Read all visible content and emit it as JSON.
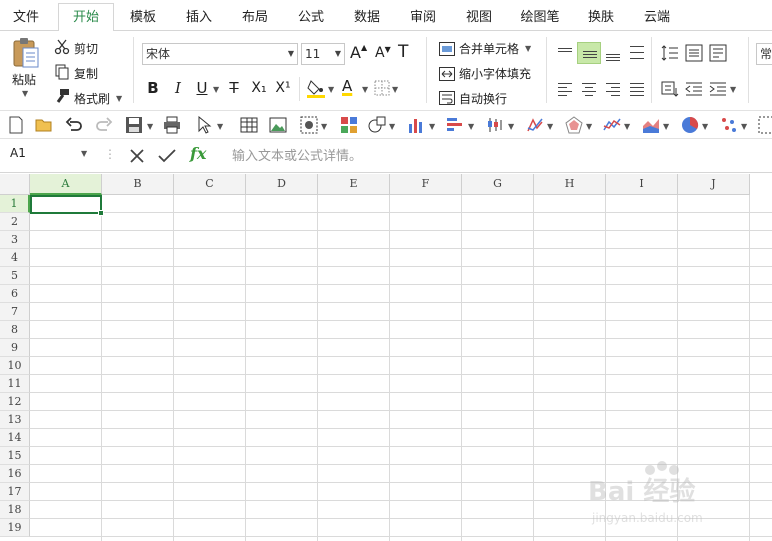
{
  "menu": {
    "tabs": [
      "文件",
      "开始",
      "模板",
      "插入",
      "布局",
      "公式",
      "数据",
      "审阅",
      "视图",
      "绘图笔",
      "换肤",
      "云端"
    ],
    "active": "开始"
  },
  "clipboard": {
    "paste": "粘贴",
    "cut": "剪切",
    "copy": "复制",
    "format_painter": "格式刷"
  },
  "font": {
    "name": "宋体",
    "size": "11",
    "grow": "A",
    "shrink": "A",
    "clear": "T"
  },
  "format": {
    "bold": "B",
    "italic": "I",
    "underline": "U",
    "strike": "T",
    "subscript": "X₁",
    "superscript": "X¹",
    "font_color_letter": "A",
    "fill_color": "#ffd800",
    "font_color": "#ffd800"
  },
  "merge": {
    "merge_cells": "合并单元格",
    "shrink_fit": "缩小字体填充",
    "wrap_text": "自动换行"
  },
  "styles_partial": "常",
  "formula_bar": {
    "name_box": "A1",
    "fx": "fx",
    "placeholder": "输入文本或公式详情。"
  },
  "columns": [
    "A",
    "B",
    "C",
    "D",
    "E",
    "F",
    "G",
    "H",
    "I",
    "J"
  ],
  "rows": [
    "1",
    "2",
    "3",
    "4",
    "5",
    "6",
    "7",
    "8",
    "9",
    "10",
    "11",
    "12",
    "13",
    "14",
    "15",
    "16",
    "17",
    "18",
    "19"
  ],
  "selection": {
    "cell": "A1",
    "column": "A",
    "row": "1"
  },
  "accent": "#2a8a4a",
  "watermark": {
    "text": "Bai 经验",
    "sub": "jingyan.baidu.com"
  }
}
